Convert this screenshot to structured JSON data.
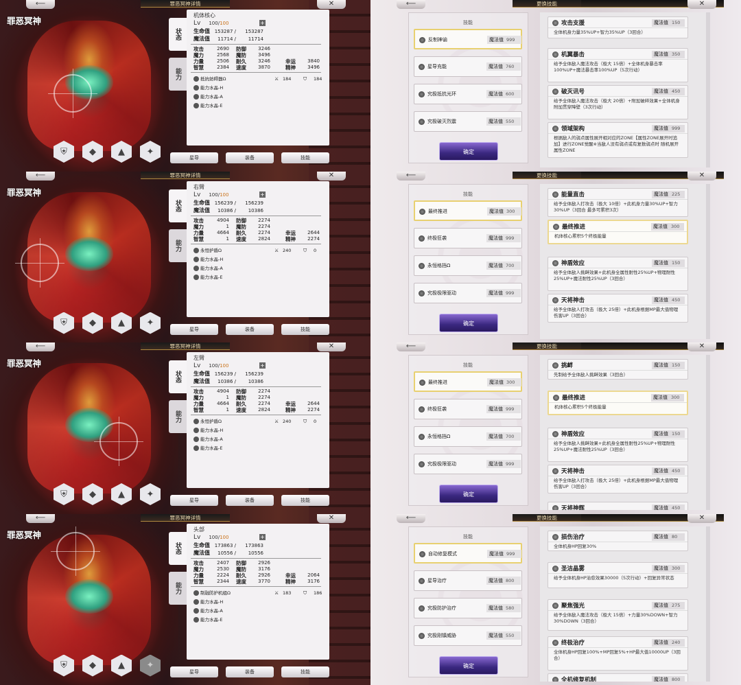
{
  "panels": [
    {
      "title": "罪恶冥神详情",
      "char_name": "罪恶冥神",
      "part": "机体核心",
      "lv": "Lv",
      "lv_cur": "100/",
      "lv_max": "100",
      "hp_label": "生命值",
      "hp_cur": "153287 /",
      "hp_max": "153287",
      "mp_label": "魔法值",
      "mp_cur": "11714 /",
      "mp_max": "11714",
      "stats": [
        [
          "攻击",
          "2690",
          "防御",
          "3246",
          "",
          ""
        ],
        [
          "魔力",
          "2568",
          "魔防",
          "3496",
          "",
          ""
        ],
        [
          "力量",
          "2506",
          "耐久",
          "3246",
          "幸运",
          "3840"
        ],
        [
          "智慧",
          "2384",
          "速度",
          "3870",
          "精神",
          "3496"
        ]
      ],
      "equip": [
        {
          "name": "抵抗妨碍器Ω",
          "v1": "184",
          "v2": "184"
        },
        {
          "name": "能力水晶-H"
        },
        {
          "name": "能力水晶-A"
        },
        {
          "name": "能力水晶-E"
        }
      ],
      "tabs": [
        "状态",
        "能力"
      ],
      "buttons": [
        "星导",
        "装备",
        "技能"
      ],
      "skills_title": "更换技能",
      "skills_label": "技能",
      "ok": "确定",
      "mp_tag": "魔法值",
      "equipped": [
        {
          "name": "反制神谕",
          "mp": "999"
        },
        {
          "name": "星导充能",
          "mp": "760"
        },
        {
          "name": "究极抵抗光环",
          "mp": "600"
        },
        {
          "name": "究极破灭烈震",
          "mp": "550"
        }
      ],
      "list": [
        {
          "name": "攻击支援",
          "mp": "150",
          "desc": "全体机身力量35%UP+智力35%UP（3回合）"
        },
        {
          "name": "机翼暴击",
          "mp": "350",
          "desc": "给予全体敌人魔法攻击（极大 15倍）+全体机身暴击率100%UP+魔法暴击率100%UP（5次行动）"
        },
        {
          "name": "破灭讯号",
          "mp": "450",
          "desc": "给予全体敌人魔法攻击（极大 20倍）+附加破碎效果+全体机身附加贯穿障壁（3次行动）"
        },
        {
          "name": "领域架构",
          "mp": "999",
          "desc": "根据敌人的弱点属性展开相对应的ZONE【属性ZONE展开时追加】进行ZONE觉醒※当敌人没有弱点或有复数弱点时 随机展开属性ZONE"
        }
      ]
    },
    {
      "title": "罪恶冥神详情",
      "char_name": "罪恶冥神",
      "part": "右臂",
      "lv": "Lv",
      "lv_cur": "100/",
      "lv_max": "100",
      "hp_label": "生命值",
      "hp_cur": "156239 /",
      "hp_max": "156239",
      "mp_label": "魔法值",
      "mp_cur": "10386 /",
      "mp_max": "10386",
      "stats": [
        [
          "攻击",
          "4904",
          "防御",
          "2274",
          "",
          ""
        ],
        [
          "魔力",
          "1",
          "魔防",
          "2274",
          "",
          ""
        ],
        [
          "力量",
          "4664",
          "耐久",
          "2274",
          "幸运",
          "2644"
        ],
        [
          "智慧",
          "1",
          "速度",
          "2824",
          "精神",
          "2274"
        ]
      ],
      "equip": [
        {
          "name": "永恒护盾Ω",
          "v1": "240",
          "v2": "0"
        },
        {
          "name": "能力水晶-H"
        },
        {
          "name": "能力水晶-A"
        },
        {
          "name": "能力水晶-E"
        }
      ],
      "tabs": [
        "状态",
        "能力"
      ],
      "buttons": [
        "星导",
        "装备",
        "技能"
      ],
      "skills_title": "更换技能",
      "skills_label": "技能",
      "ok": "确定",
      "mp_tag": "魔法值",
      "equipped": [
        {
          "name": "最终推进",
          "mp": "300"
        },
        {
          "name": "终极狂袭",
          "mp": "999"
        },
        {
          "name": "永恒格挡Ω",
          "mp": "700"
        },
        {
          "name": "究极极限驱动",
          "mp": "999"
        }
      ],
      "list": [
        {
          "name": "能量直击",
          "mp": "225",
          "desc": "给予全体敌人打攻击（极大 10倍）+此机身力量30%UP+智力30%UP（3回合 最多可累积3次）"
        },
        {
          "name": "最终推进",
          "mp": "300",
          "desc": "机体核心累积5个终极能量"
        },
        {
          "name": "神盾效应",
          "mp": "150",
          "desc": "给予全体敌人挑衅效果+此机身全属性耐性25%UP+物理耐性25%UP+魔法耐性25%UP（3回合）"
        },
        {
          "name": "天将神击",
          "mp": "450",
          "desc": "给予全体敌人打攻击（极大 25倍）+此机身根据MP最大值物理伤害UP（3回合）"
        }
      ]
    },
    {
      "title": "罪恶冥神详情",
      "char_name": "罪恶冥神",
      "part": "左臂",
      "lv": "Lv",
      "lv_cur": "100/",
      "lv_max": "100",
      "hp_label": "生命值",
      "hp_cur": "156239 /",
      "hp_max": "156239",
      "mp_label": "魔法值",
      "mp_cur": "10386 /",
      "mp_max": "10386",
      "stats": [
        [
          "攻击",
          "4904",
          "防御",
          "2274",
          "",
          ""
        ],
        [
          "魔力",
          "1",
          "魔防",
          "2274",
          "",
          ""
        ],
        [
          "力量",
          "4664",
          "耐久",
          "2274",
          "幸运",
          "2644"
        ],
        [
          "智慧",
          "1",
          "速度",
          "2824",
          "精神",
          "2274"
        ]
      ],
      "equip": [
        {
          "name": "永恒护盾Ω",
          "v1": "240",
          "v2": "0"
        },
        {
          "name": "能力水晶-H"
        },
        {
          "name": "能力水晶-A"
        },
        {
          "name": "能力水晶-E"
        }
      ],
      "tabs": [
        "状态",
        "能力"
      ],
      "buttons": [
        "星导",
        "装备",
        "技能"
      ],
      "skills_title": "更换技能",
      "skills_label": "技能",
      "ok": "确定",
      "mp_tag": "魔法值",
      "equipped": [
        {
          "name": "最终推进",
          "mp": "300"
        },
        {
          "name": "终极狂袭",
          "mp": "999"
        },
        {
          "name": "永恒格挡Ω",
          "mp": "700"
        },
        {
          "name": "究极极限驱动",
          "mp": "999"
        }
      ],
      "list": [
        {
          "name": "挑衅",
          "mp": "150",
          "desc": "先制给予全体敌人挑衅效果（3回合）"
        },
        {
          "name": "最终推进",
          "mp": "300",
          "desc": "机体核心累积5个终极能量"
        },
        {
          "name": "神盾效应",
          "mp": "150",
          "desc": "给予全体敌人挑衅效果+此机身全属性耐性25%UP+物理耐性25%UP+魔法耐性25%UP（3回合）"
        },
        {
          "name": "天将神击",
          "mp": "450",
          "desc": "给予全体敌人打攻击（极大 25倍）+此机身根据MP最大值物理伤害UP（3回合）"
        },
        {
          "name": "天将神辉",
          "mp": "450",
          "desc": ""
        }
      ]
    },
    {
      "title": "罪恶冥神详情",
      "char_name": "罪恶冥神",
      "part": "头部",
      "lv": "Lv",
      "lv_cur": "100/",
      "lv_max": "100",
      "hp_label": "生命值",
      "hp_cur": "173863 /",
      "hp_max": "173863",
      "mp_label": "魔法值",
      "mp_cur": "10556 /",
      "mp_max": "10556",
      "stats": [
        [
          "攻击",
          "2407",
          "防御",
          "2926",
          "",
          ""
        ],
        [
          "魔力",
          "2530",
          "魔防",
          "3176",
          "",
          ""
        ],
        [
          "力量",
          "2224",
          "耐久",
          "2926",
          "幸运",
          "2064"
        ],
        [
          "智慧",
          "2344",
          "速度",
          "3770",
          "精神",
          "3176"
        ]
      ],
      "equip": [
        {
          "name": "制融防护机组Ω",
          "v1": "183",
          "v2": "186"
        },
        {
          "name": "能力水晶-H"
        },
        {
          "name": "能力水晶-A"
        },
        {
          "name": "能力水晶-E"
        }
      ],
      "tabs": [
        "状态",
        "能力"
      ],
      "buttons": [
        "星导",
        "装备",
        "技能"
      ],
      "skills_title": "更换技能",
      "skills_label": "技能",
      "ok": "确定",
      "mp_tag": "魔法值",
      "equipped": [
        {
          "name": "自动修复模式",
          "mp": "999"
        },
        {
          "name": "星导治疗",
          "mp": "800"
        },
        {
          "name": "究极防护治疗",
          "mp": "580"
        },
        {
          "name": "究极刚镇威胁",
          "mp": "550"
        }
      ],
      "list": [
        {
          "name": "损伤治疗",
          "mp": "80",
          "desc": "全体机身HP回复30%"
        },
        {
          "name": "圣洁晶雾",
          "mp": "300",
          "desc": "给予全体机身HP治愈效果30000（5次行动）+回复异常状态"
        },
        {
          "name": "聚焦强光",
          "mp": "275",
          "desc": "给予全体敌人魔法攻击（极大 15倍）+力量30%DOWN+智力30%DOWN（3回合）"
        },
        {
          "name": "终极治疗",
          "mp": "240",
          "desc": "全体机身HP回复100%+MP回复5%+HP最大值10000UP（3回合）"
        },
        {
          "name": "全机修复机制",
          "mp": "800",
          "desc": ""
        }
      ]
    }
  ]
}
